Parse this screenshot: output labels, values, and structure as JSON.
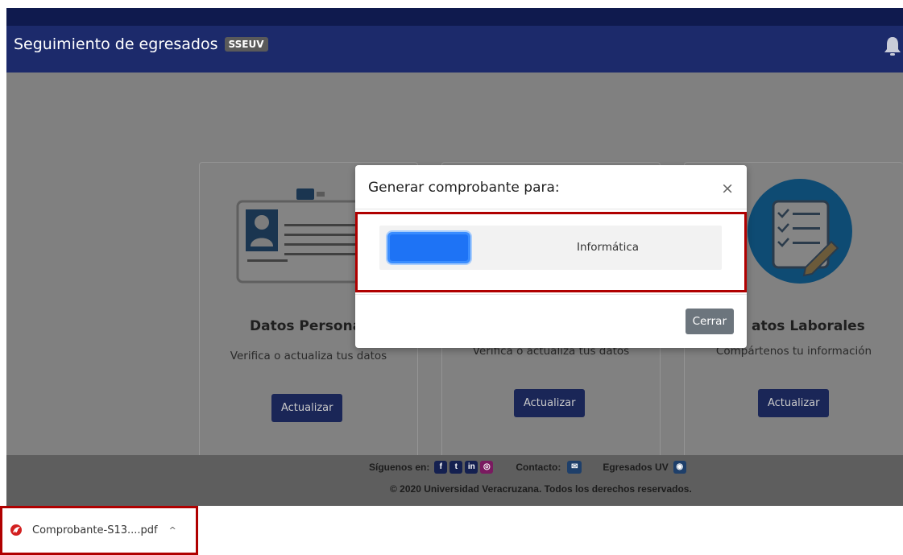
{
  "navbar": {
    "title": "Seguimiento de egresados",
    "badge": "SSEUV",
    "bell_icon": "bell-icon"
  },
  "cards": [
    {
      "title": "Datos Personales",
      "title_visible": "Datos Personal",
      "subtitle": "Verifica o actualiza tus datos",
      "button": "Actualizar"
    },
    {
      "title": "",
      "subtitle": "Verifica o actualiza tus datos",
      "button": "Actualizar"
    },
    {
      "title_visible": "atos Laborales",
      "subtitle": "Compártenos tu información",
      "button": "Actualizar"
    }
  ],
  "modal": {
    "title": "Generar comprobante para:",
    "close_symbol": "×",
    "items": [
      {
        "code": "",
        "program": "Informática"
      }
    ],
    "close_button": "Cerrar"
  },
  "footer": {
    "follow_label": "Síguenos en:",
    "contact_label": "Contacto:",
    "egresados_label": "Egresados UV",
    "copyright": "© 2020 Universidad Veracruzana. Todos los derechos reservados.",
    "social_icons": [
      "facebook-icon",
      "twitter-icon",
      "linkedin-icon",
      "instagram-icon"
    ]
  },
  "download": {
    "filename": "Comprobante-S13....pdf",
    "chevron": "^"
  },
  "colors": {
    "navbar": "#1c2a6b",
    "overlay": "#808080",
    "button_dark": "#1a2657",
    "highlight": "#b00000",
    "primary_blue": "#1e73f5"
  }
}
